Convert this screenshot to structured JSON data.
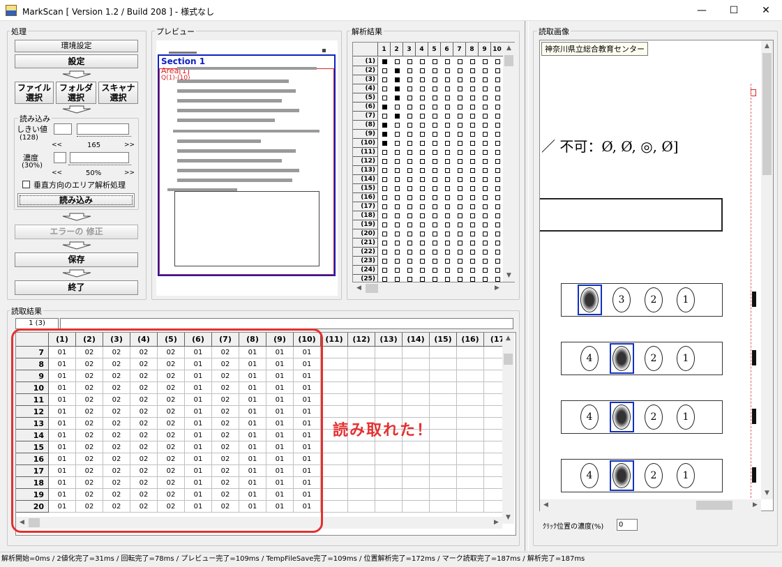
{
  "window": {
    "title": "MarkScan [ Version 1.2 / Build 208 ] - 様式なし",
    "minimize": "—",
    "maximize": "☐",
    "close": "✕"
  },
  "processing": {
    "label": "処理",
    "env_settings": "環境設定",
    "settings": "設定",
    "file_select": "ファイル\n選択",
    "folder_select": "フォルダ\n選択",
    "scanner_select": "スキャナ\n選択",
    "load_group_label": "読み込み",
    "threshold_label": "しきい値",
    "threshold_default": "(128)",
    "threshold_value": "165",
    "density_label": "濃度",
    "density_default": "(30%)",
    "density_value": "50%",
    "vertical_area_label": "垂直方向のエリア解析処理",
    "scroll_left": "<<",
    "scroll_right": ">>",
    "load": "読み込み",
    "fix_errors": "エラーの 修正",
    "save": "保存",
    "exit": "終了"
  },
  "preview": {
    "label": "プレビュー",
    "section": "Section 1",
    "area": "Area[1]",
    "question_range": "Q(1)-(10)"
  },
  "analysis": {
    "label": "解析結果",
    "columns": [
      "1",
      "2",
      "3",
      "4",
      "5",
      "6",
      "7",
      "8",
      "9",
      "10"
    ],
    "rows": [
      "(1)",
      "(2)",
      "(3)",
      "(4)",
      "(5)",
      "(6)",
      "(7)",
      "(8)",
      "(9)",
      "(10)",
      "(11)",
      "(12)",
      "(13)",
      "(14)",
      "(15)",
      "(16)",
      "(17)",
      "(18)",
      "(19)",
      "(20)",
      "(21)",
      "(22)",
      "(23)",
      "(24)",
      "(25)"
    ],
    "marked": [
      [
        0
      ],
      [
        1
      ],
      [
        1
      ],
      [
        1
      ],
      [
        1
      ],
      [
        0
      ],
      [
        1
      ],
      [
        0
      ],
      [
        0
      ],
      [
        0
      ]
    ]
  },
  "results": {
    "label": "読取結果",
    "selector_value": "1 (3)",
    "columns": [
      "(1)",
      "(2)",
      "(3)",
      "(4)",
      "(5)",
      "(6)",
      "(7)",
      "(8)",
      "(9)",
      "(10)",
      "(11)",
      "(12)",
      "(13)",
      "(14)",
      "(15)",
      "(16)",
      "(17"
    ],
    "rows": [
      {
        "id": "7",
        "v": [
          "01",
          "02",
          "02",
          "02",
          "02",
          "01",
          "02",
          "01",
          "01",
          "01"
        ]
      },
      {
        "id": "8",
        "v": [
          "01",
          "02",
          "02",
          "02",
          "02",
          "01",
          "02",
          "01",
          "01",
          "01"
        ]
      },
      {
        "id": "9",
        "v": [
          "01",
          "02",
          "02",
          "02",
          "02",
          "01",
          "02",
          "01",
          "01",
          "01"
        ]
      },
      {
        "id": "10",
        "v": [
          "01",
          "02",
          "02",
          "02",
          "02",
          "01",
          "02",
          "01",
          "01",
          "01"
        ]
      },
      {
        "id": "11",
        "v": [
          "01",
          "02",
          "02",
          "02",
          "02",
          "01",
          "02",
          "01",
          "01",
          "01"
        ]
      },
      {
        "id": "12",
        "v": [
          "01",
          "02",
          "02",
          "02",
          "02",
          "01",
          "02",
          "01",
          "01",
          "01"
        ]
      },
      {
        "id": "13",
        "v": [
          "01",
          "02",
          "02",
          "02",
          "02",
          "01",
          "02",
          "01",
          "01",
          "01"
        ]
      },
      {
        "id": "14",
        "v": [
          "01",
          "02",
          "02",
          "02",
          "02",
          "01",
          "02",
          "01",
          "01",
          "01"
        ]
      },
      {
        "id": "15",
        "v": [
          "01",
          "02",
          "02",
          "02",
          "02",
          "01",
          "02",
          "01",
          "01",
          "01"
        ]
      },
      {
        "id": "16",
        "v": [
          "01",
          "02",
          "02",
          "02",
          "02",
          "01",
          "02",
          "01",
          "01",
          "01"
        ]
      },
      {
        "id": "17",
        "v": [
          "01",
          "02",
          "02",
          "02",
          "02",
          "01",
          "02",
          "01",
          "01",
          "01"
        ]
      },
      {
        "id": "18",
        "v": [
          "01",
          "02",
          "02",
          "02",
          "02",
          "01",
          "02",
          "01",
          "01",
          "01"
        ]
      },
      {
        "id": "19",
        "v": [
          "01",
          "02",
          "02",
          "02",
          "02",
          "01",
          "02",
          "01",
          "01",
          "01"
        ]
      },
      {
        "id": "20",
        "v": [
          "01",
          "02",
          "02",
          "02",
          "02",
          "01",
          "02",
          "01",
          "01",
          "01"
        ]
      }
    ],
    "annotation": "読み取れた！",
    "annotation_color": "#e53030"
  },
  "scan_image": {
    "label": "読取画像",
    "tooltip": "神奈川県立総合教育センター",
    "handwritten": "／ 不可：Ø, Ø, ◎, Ø]",
    "bubble_rows": [
      [
        "",
        "3",
        "2",
        "1"
      ],
      [
        "4",
        "",
        "2",
        "1"
      ],
      [
        "4",
        "",
        "2",
        "1"
      ],
      [
        "4",
        "",
        "2",
        "1"
      ]
    ],
    "click_density_label": "ｸﾘｯｸ位置の濃度(%)",
    "click_density_value": "0"
  },
  "status": "解析開始=0ms / 2値化完了=31ms / 回転完了=78ms / プレビュー完了=109ms / TempFileSave完了=109ms / 位置解析完了=172ms / マーク読取完了=187ms / 解析完了=187ms"
}
